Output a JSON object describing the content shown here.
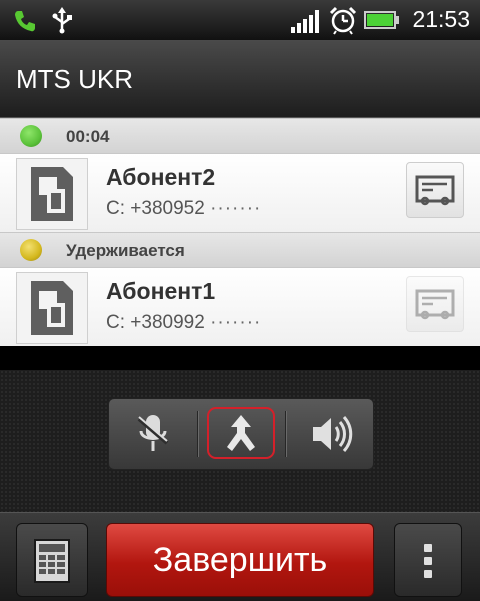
{
  "status_bar": {
    "time": "21:53",
    "icons": [
      "call-active-icon",
      "usb-icon",
      "signal-icon",
      "alarm-icon",
      "battery-icon"
    ],
    "call_icon_color": "#58c832",
    "battery_color": "#4cd136"
  },
  "header": {
    "title": "MTS UKR"
  },
  "calls": [
    {
      "state_color": "#5bc23a",
      "state_text": "00:04",
      "name": "Абонент2",
      "number": "С: +380952",
      "masked": "·······",
      "card_enabled": true
    },
    {
      "state_color": "#d4b81e",
      "state_text": "Удерживается",
      "name": "Абонент1",
      "number": "С: +380992",
      "masked": "·······",
      "card_enabled": false
    }
  ],
  "controls": {
    "icons": [
      "mute-microphone-icon",
      "merge-calls-icon",
      "speaker-icon"
    ],
    "highlight_color": "#d4202a"
  },
  "bottom_bar": {
    "end_call_label": "Завершить",
    "end_call_color": "#c1201a",
    "icons": [
      "dialpad-icon",
      "more-options-icon"
    ]
  }
}
